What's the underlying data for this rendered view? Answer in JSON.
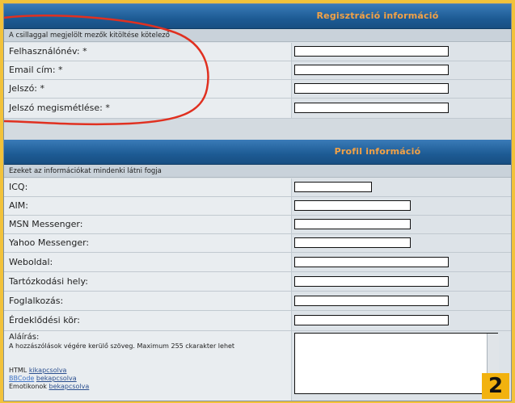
{
  "registration": {
    "title": "Regisztráció információ",
    "note": "A csillaggal megjelölt mezők kitöltése kötelező",
    "fields": [
      {
        "label": "Felhasználónév: *",
        "value": ""
      },
      {
        "label": "Email cím: *",
        "value": ""
      },
      {
        "label": "Jelszó: *",
        "value": ""
      },
      {
        "label": "Jelszó megismétlése: *",
        "value": ""
      }
    ]
  },
  "profile": {
    "title": "Profil információ",
    "note": "Ezeket az információkat mindenki látni fogja",
    "fields": [
      {
        "label": "ICQ:",
        "value": ""
      },
      {
        "label": "AIM:",
        "value": ""
      },
      {
        "label": "MSN Messenger:",
        "value": ""
      },
      {
        "label": "Yahoo Messenger:",
        "value": ""
      },
      {
        "label": "Weboldal:",
        "value": ""
      },
      {
        "label": "Tartózkodási hely:",
        "value": ""
      },
      {
        "label": "Foglalkozás:",
        "value": ""
      },
      {
        "label": "Érdeklődési kör:",
        "value": ""
      }
    ],
    "signature": {
      "label": "Aláírás:",
      "help": "A hozzászólások végére kerülő szöveg. Maximum 255 ckarakter lehet",
      "html_prefix": "HTML",
      "html_state": "kikapcsolva",
      "bbcode_label": "BBCode",
      "bbcode_state": "bekapcsolva",
      "emoticons_prefix": "Emotikonok",
      "emoticons_state": "bekapcsolva",
      "value": ""
    }
  },
  "badge": "2",
  "colors": {
    "header": "#1d5b94",
    "header_text": "#f3a246",
    "annotation": "#e03020",
    "border": "#f2c23a"
  }
}
